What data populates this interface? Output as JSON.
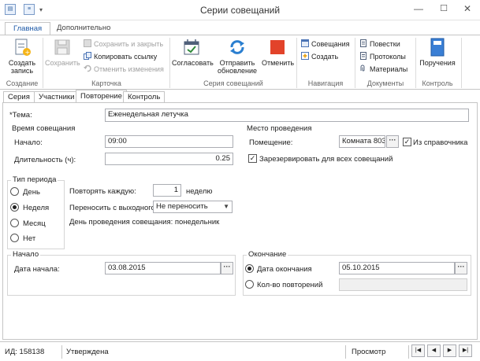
{
  "window": {
    "title": "Серии совещаний",
    "controls": [
      "—",
      "☐",
      "✕"
    ]
  },
  "ribbon": {
    "tabs": [
      {
        "label": "Главная",
        "active": true
      },
      {
        "label": "Дополнительно",
        "active": false
      }
    ],
    "groups": {
      "create": {
        "label": "Создание",
        "create_record": "Создать запись"
      },
      "card": {
        "label": "Карточка",
        "save": "Сохранить",
        "save_and_close": "Сохранить и закрыть",
        "copy_link": "Копировать ссылку",
        "undo_changes": "Отменить изменения"
      },
      "series": {
        "label": "Серия совещаний",
        "approve": "Согласовать",
        "send_update": "Отправить обновление",
        "cancel": "Отменить"
      },
      "navigation": {
        "label": "Навигация",
        "meetings": "Совещания",
        "create": "Создать"
      },
      "documents": {
        "label": "Документы",
        "agendas": "Повестки",
        "protocols": "Протоколы",
        "materials": "Материалы"
      },
      "control": {
        "label": "Контроль",
        "assignments": "Поручения"
      }
    },
    "colors": {
      "accent": "#1e5aa8",
      "cancel_red": "#e2432a"
    }
  },
  "form_tabs": [
    {
      "label": "Серия",
      "active": false
    },
    {
      "label": "Участники",
      "active": false
    },
    {
      "label": "Повторение",
      "active": true
    },
    {
      "label": "Контроль",
      "active": false
    }
  ],
  "form": {
    "topic_label": "*Тема:",
    "topic_value": "Еженедельная летучка",
    "time": {
      "group_label": "Время совещания",
      "start_label": "Начало:",
      "start_value": "09:00",
      "duration_label": "Длительность (ч):",
      "duration_value": "0.25"
    },
    "place": {
      "group_label": "Место проведения",
      "room_label": "Помещение:",
      "room_value": "Комната 803",
      "from_directory_label": "Из справочника",
      "from_directory_checked": true,
      "reserve_label": "Зарезервировать для всех совещаний",
      "reserve_checked": true
    },
    "period": {
      "group_label": "Тип периода",
      "options": [
        {
          "label": "День",
          "selected": false
        },
        {
          "label": "Неделя",
          "selected": true
        },
        {
          "label": "Месяц",
          "selected": false
        },
        {
          "label": "Нет",
          "selected": false
        }
      ]
    },
    "repeat": {
      "every_label": "Повторять каждую:",
      "every_value": "1",
      "unit": "неделю",
      "move_label": "Переносить с выходного:",
      "move_value": "Не переносить",
      "day_text": "День проведения совещания: понедельник"
    },
    "start": {
      "group_label": "Начало",
      "date_label": "Дата начала:",
      "date_value": "03.08.2015"
    },
    "end": {
      "group_label": "Окончание",
      "end_date_label": "Дата окончания",
      "end_date_value": "05.10.2015",
      "end_date_selected": true,
      "count_label": "Кол-во повторений",
      "count_selected": false,
      "count_value": ""
    }
  },
  "status": {
    "id": "ИД: 158138",
    "state": "Утверждена",
    "mode": "Просмотр",
    "nav": [
      "|◀",
      "◀",
      "▶",
      "▶|"
    ]
  }
}
